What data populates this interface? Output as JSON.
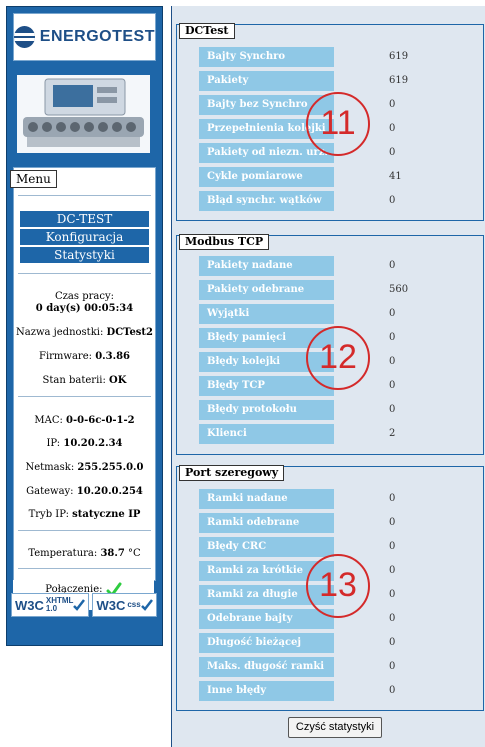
{
  "sidebar": {
    "logo_text": "ENERGOTEST",
    "menu_title": "Menu",
    "menu_items": [
      {
        "label": "DC-TEST"
      },
      {
        "label": "Konfiguracja"
      },
      {
        "label": "Statystyki"
      }
    ],
    "uptime_label": "Czas pracy:",
    "uptime_value": "0 day(s) 00:05:34",
    "unit_name_label": "Nazwa jednostki:",
    "unit_name_value": "DCTest2",
    "firmware_label": "Firmware:",
    "firmware_value": "0.3.86",
    "battery_label": "Stan baterii:",
    "battery_value": "OK",
    "mac_label": "MAC:",
    "mac_value": "0-0-6c-0-1-2",
    "ip_label": "IP:",
    "ip_value": "10.20.2.34",
    "netmask_label": "Netmask:",
    "netmask_value": "255.255.0.0",
    "gateway_label": "Gateway:",
    "gateway_value": "10.20.0.254",
    "ipmode_label": "Tryb IP:",
    "ipmode_value": "statyczne IP",
    "temp_label": "Temperatura:",
    "temp_value": "38.7",
    "temp_unit": "°C",
    "connection_label": "Połączenie:",
    "connection_icon": "check-icon",
    "badges": [
      {
        "w3c": "W3C",
        "line1": "XHTML",
        "line2": "1.0"
      },
      {
        "w3c": "W3C",
        "line1": "css",
        "line2": ""
      }
    ]
  },
  "sections": [
    {
      "title": "DCTest",
      "annotation": "11",
      "rows": [
        {
          "label": "Bajty Synchro",
          "value": "619"
        },
        {
          "label": "Pakiety",
          "value": "619"
        },
        {
          "label": "Bajty bez Synchro",
          "value": "0"
        },
        {
          "label": "Przepełnienia kolejki",
          "value": "0"
        },
        {
          "label": "Pakiety od niezn. urz.",
          "value": "0"
        },
        {
          "label": "Cykle pomiarowe",
          "value": "41"
        },
        {
          "label": "Błąd synchr. wątków",
          "value": "0"
        }
      ]
    },
    {
      "title": "Modbus TCP",
      "annotation": "12",
      "rows": [
        {
          "label": "Pakiety nadane",
          "value": "0"
        },
        {
          "label": "Pakiety odebrane",
          "value": "560"
        },
        {
          "label": "Wyjątki",
          "value": "0"
        },
        {
          "label": "Błędy pamięci",
          "value": "0"
        },
        {
          "label": "Błędy kolejki",
          "value": "0"
        },
        {
          "label": "Błędy TCP",
          "value": "0"
        },
        {
          "label": "Błędy protokołu",
          "value": "0"
        },
        {
          "label": "Klienci",
          "value": "2"
        }
      ]
    },
    {
      "title": "Port szeregowy",
      "annotation": "13",
      "rows": [
        {
          "label": "Ramki nadane",
          "value": "0"
        },
        {
          "label": "Ramki odebrane",
          "value": "0"
        },
        {
          "label": "Błędy CRC",
          "value": "0"
        },
        {
          "label": "Ramki za krótkie",
          "value": "0"
        },
        {
          "label": "Ramki za długie",
          "value": "0"
        },
        {
          "label": "Odebrane bajty",
          "value": "0"
        },
        {
          "label": "Długość bieżącej ramki",
          "value": "0"
        },
        {
          "label": "Maks. długość ramki",
          "value": "0"
        },
        {
          "label": "Inne błędy",
          "value": "0"
        }
      ]
    }
  ],
  "clear_button_label": "Czyść statystyki",
  "colors": {
    "sidebar_bg": "#1e66a8",
    "row_label_bg": "#8fc8e6",
    "annotation": "#d42a2a",
    "check": "#2ecc40"
  }
}
